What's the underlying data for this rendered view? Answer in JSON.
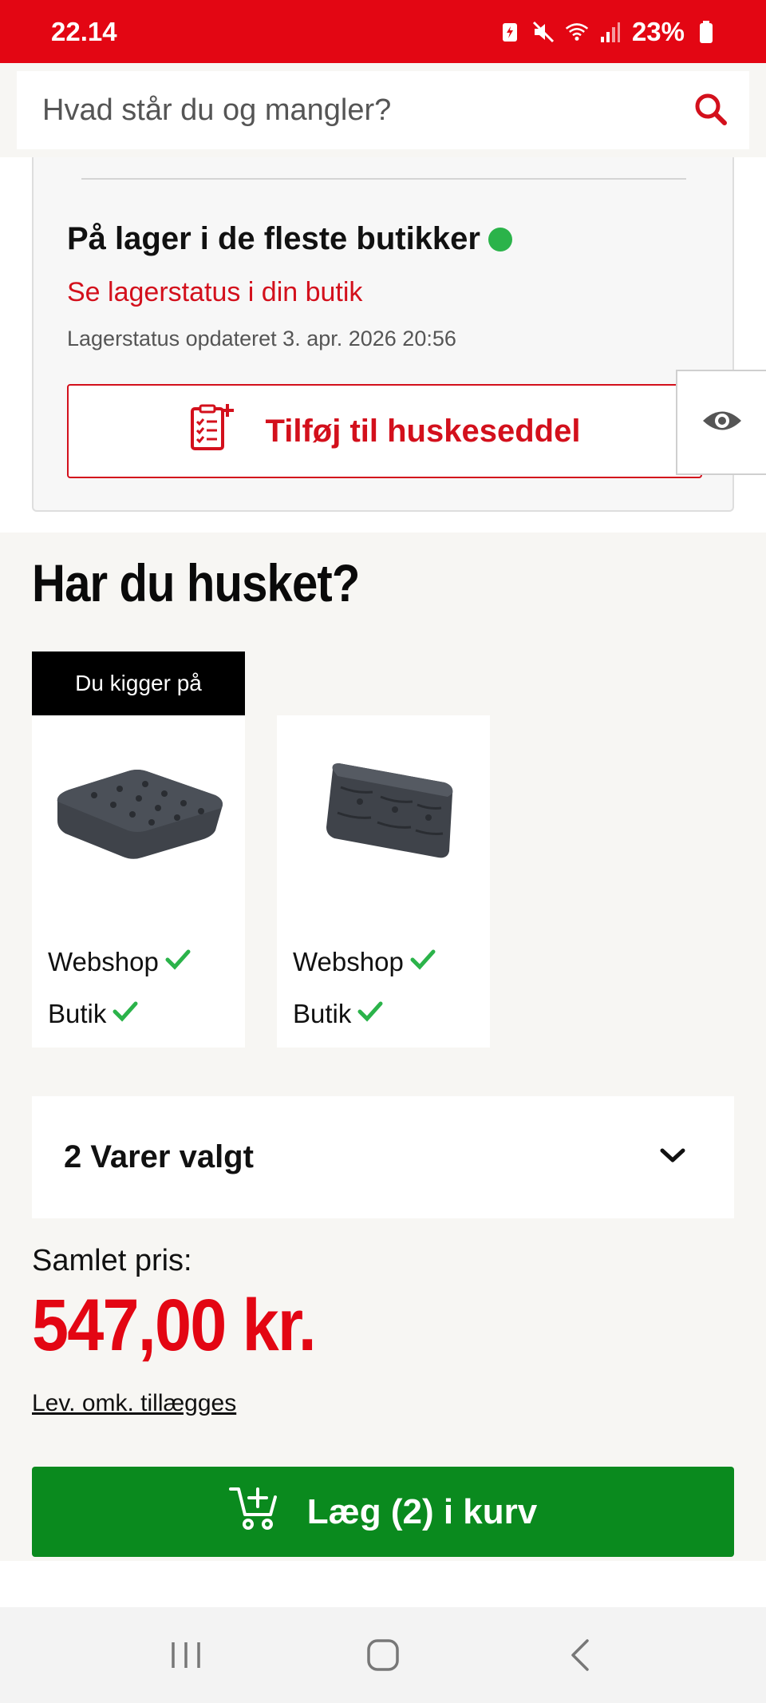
{
  "status_bar": {
    "time": "22.14",
    "battery": "23%"
  },
  "search": {
    "placeholder": "Hvad står du og mangler?"
  },
  "availability": {
    "title": "På lager i de fleste butikker",
    "store_link": "Se lagerstatus i din butik",
    "updated": "Lagerstatus opdateret 3. apr. 2026 20:56",
    "wishlist_button": "Tilføj til huskeseddel"
  },
  "recommendations": {
    "title": "Har du husket?",
    "viewing_badge": "Du kigger på",
    "products": [
      {
        "webshop_label": "Webshop",
        "store_label": "Butik"
      },
      {
        "webshop_label": "Webshop",
        "store_label": "Butik"
      }
    ]
  },
  "selection": {
    "label": "2 Varer valgt"
  },
  "total": {
    "label": "Samlet pris:",
    "price": "547,00 kr.",
    "delivery_note": "Lev. omk. tillægges"
  },
  "cart_button": {
    "label": "Læg (2) i kurv"
  },
  "colors": {
    "brand_red": "#e30613",
    "cta_green": "#0a8a1e",
    "in_stock_green": "#2bb34a"
  },
  "icons": {
    "search": "search-icon",
    "wishlist": "checklist-add-icon",
    "eye": "eye-icon",
    "check": "check-icon",
    "chevron": "chevron-down-icon",
    "cart": "cart-add-icon"
  }
}
